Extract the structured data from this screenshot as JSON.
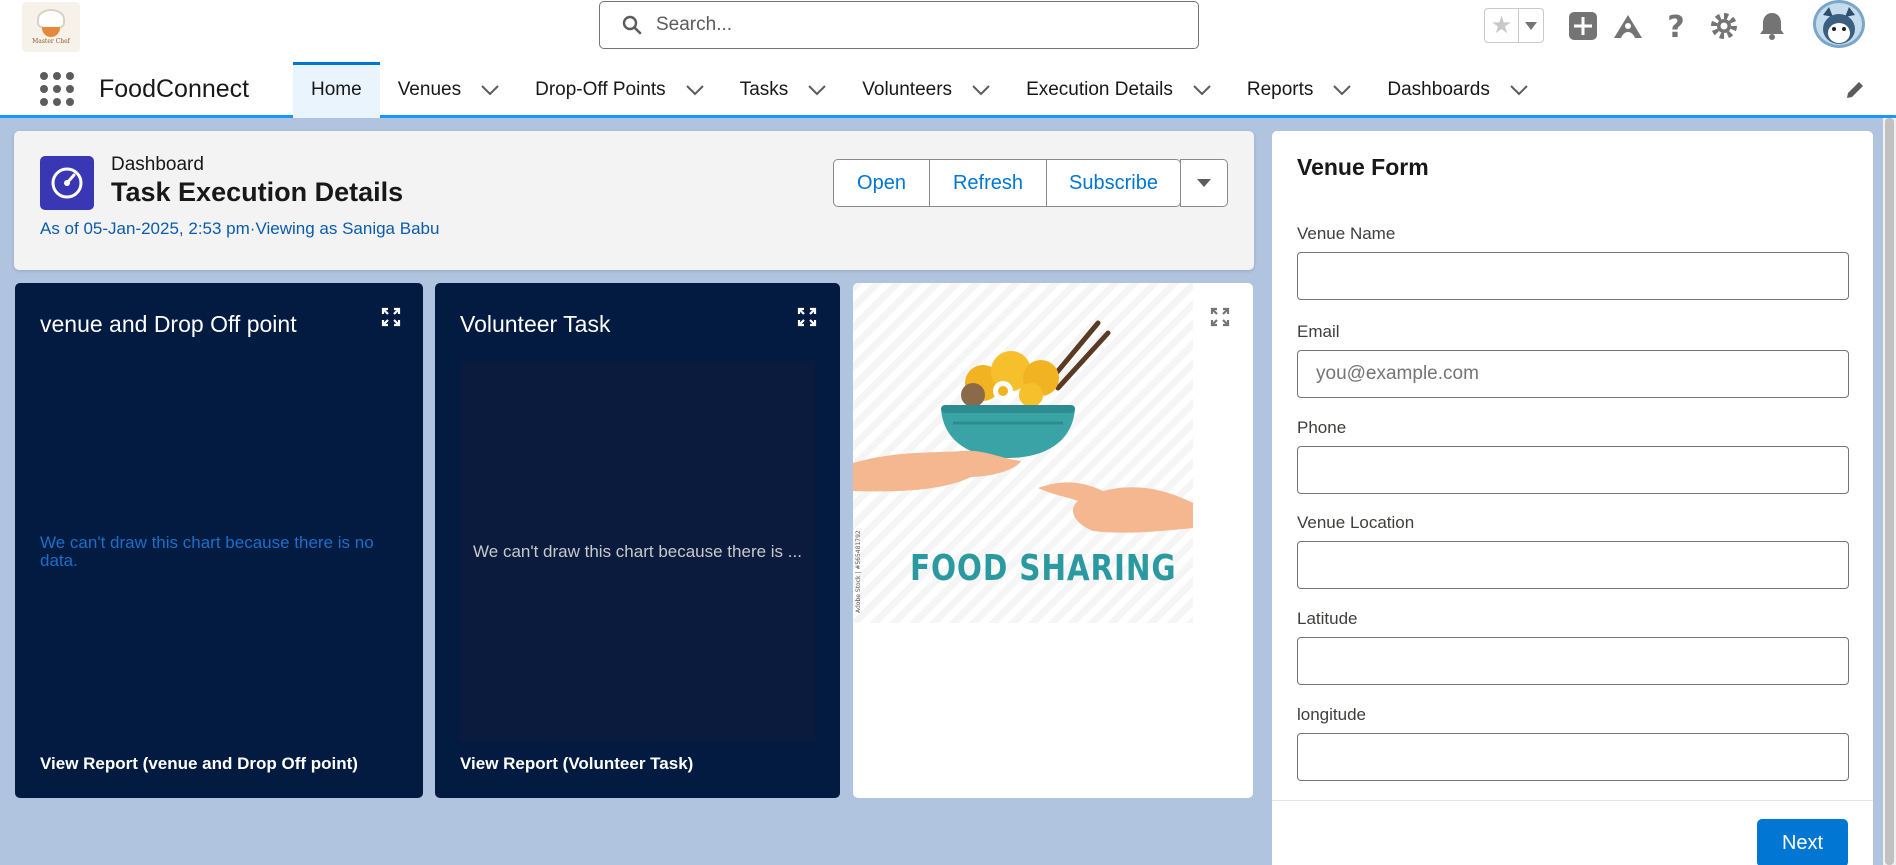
{
  "header": {
    "logo_text": "Master Chef",
    "search_placeholder": "Search...",
    "icons": [
      "search-icon",
      "star-icon",
      "chevron-down-icon",
      "add-icon",
      "trailhead-icon",
      "help-icon",
      "gear-icon",
      "bell-icon",
      "avatar"
    ]
  },
  "nav": {
    "app_name": "FoodConnect",
    "items": [
      {
        "label": "Home",
        "active": true
      },
      {
        "label": "Venues"
      },
      {
        "label": "Drop-Off Points"
      },
      {
        "label": "Tasks"
      },
      {
        "label": "Volunteers"
      },
      {
        "label": "Execution Details"
      },
      {
        "label": "Reports"
      },
      {
        "label": "Dashboards"
      }
    ]
  },
  "dashboard": {
    "type_label": "Dashboard",
    "title": "Task Execution Details",
    "subtitle": "As of 05-Jan-2025, 2:53 pm·Viewing as Saniga Babu",
    "buttons": {
      "open": "Open",
      "refresh": "Refresh",
      "subscribe": "Subscribe"
    }
  },
  "widgets": {
    "w1": {
      "title": "venue and Drop Off point",
      "message": "We can't draw this chart because there is no data.",
      "footer": "View Report (venue and Drop Off point)"
    },
    "w2": {
      "title": "Volunteer Task",
      "message": "We can't draw this chart because there is ...",
      "footer": "View Report (Volunteer Task)"
    },
    "w3": {
      "image_caption": "FOOD SHARING"
    }
  },
  "venue_form": {
    "title": "Venue Form",
    "fields": {
      "venue_name": {
        "label": "Venue Name",
        "value": "",
        "placeholder": ""
      },
      "email": {
        "label": "Email",
        "value": "",
        "placeholder": "you@example.com"
      },
      "phone": {
        "label": "Phone",
        "value": "",
        "placeholder": ""
      },
      "venue_location": {
        "label": "Venue Location",
        "value": "",
        "placeholder": ""
      },
      "latitude": {
        "label": "Latitude",
        "value": "",
        "placeholder": ""
      },
      "longitude": {
        "label": "longitude",
        "value": "",
        "placeholder": ""
      }
    },
    "next_label": "Next"
  },
  "colors": {
    "brand_blue": "#0176d3",
    "nav_accent": "#1b96ff",
    "widget_dark": "#031a41",
    "dashboard_icon": "#3a37b5",
    "background": "#b0c4df"
  }
}
